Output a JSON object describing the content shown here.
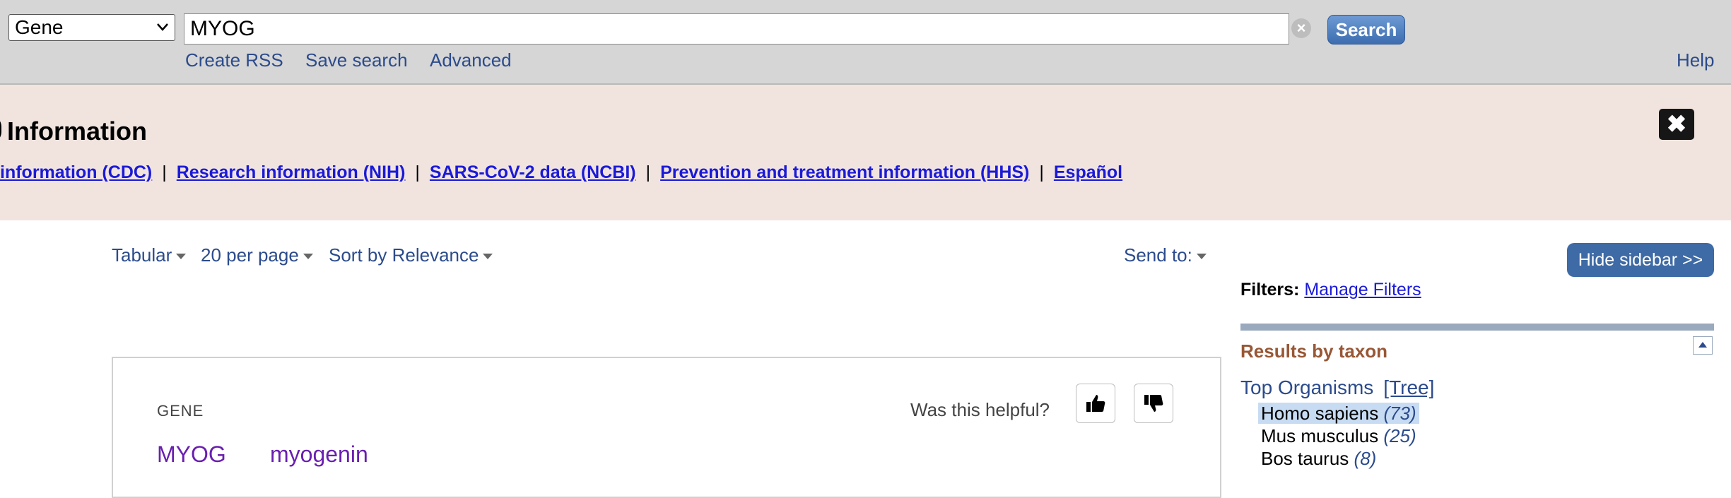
{
  "search": {
    "database": "Gene",
    "term": "MYOG",
    "button_label": "Search",
    "links": [
      "Create RSS",
      "Save search",
      "Advanced"
    ],
    "help_label": "Help"
  },
  "alert": {
    "title": "Information",
    "links": [
      "information (CDC)",
      "Research information (NIH)",
      "SARS-CoV-2 data (NCBI)",
      "Prevention and treatment information (HHS)",
      "Español"
    ],
    "separator": "|"
  },
  "toolbar": {
    "format": "Tabular",
    "per_page": "20 per page",
    "sort": "Sort by Relevance",
    "send_to": "Send to:"
  },
  "sidebar": {
    "hide_label": "Hide sidebar >>",
    "filters_label": "Filters:",
    "manage_filters": "Manage Filters",
    "results_by_taxon": "Results by taxon",
    "top_organisms": "Top Organisms",
    "tree_link": "[Tree]",
    "organisms": [
      {
        "name": "Homo sapiens",
        "count": "(73)"
      },
      {
        "name": "Mus musculus",
        "count": "(25)"
      },
      {
        "name": "Bos taurus",
        "count": "(8)"
      }
    ]
  },
  "card": {
    "label": "GENE",
    "helpful_question": "Was this helpful?",
    "gene_symbol": "MYOG",
    "gene_name": "myogenin"
  },
  "colors": {
    "link": "#2b4b8c",
    "alert_bg": "#f1e4df",
    "taxon_heading": "#985735",
    "button_blue": "#3e6aa5"
  }
}
